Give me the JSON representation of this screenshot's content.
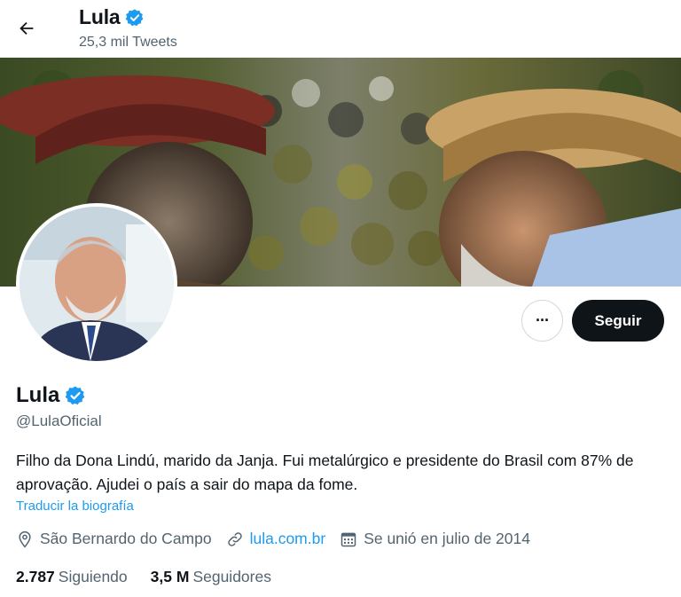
{
  "header": {
    "name": "Lula",
    "tweet_count": "25,3 mil Tweets",
    "verified": true
  },
  "profile": {
    "name": "Lula",
    "handle": "@LulaOficial",
    "bio": "Filho da Dona Lindú, marido da Janja. Fui metalúrgico e presidente do Brasil com 87% de aprovação. Ajudei o país a sair do mapa da fome.",
    "translate_label": "Traducir la biografía",
    "location": "São Bernardo do Campo",
    "website": "lula.com.br",
    "joined": "Se unió en julio de 2014"
  },
  "actions": {
    "follow_label": "Seguir",
    "more_label": "···"
  },
  "stats": {
    "following_count": "2.787",
    "following_label": "Siguiendo",
    "followers_count": "3,5 M",
    "followers_label": "Seguidores"
  },
  "icons": {
    "back": "arrow-left-icon",
    "verified": "verified-badge-icon",
    "location": "location-pin-icon",
    "link": "link-icon",
    "calendar": "calendar-icon"
  },
  "colors": {
    "accent": "#1d9bf0",
    "text_primary": "#0f1419",
    "text_secondary": "#536471",
    "follow_bg": "#0f1419"
  }
}
